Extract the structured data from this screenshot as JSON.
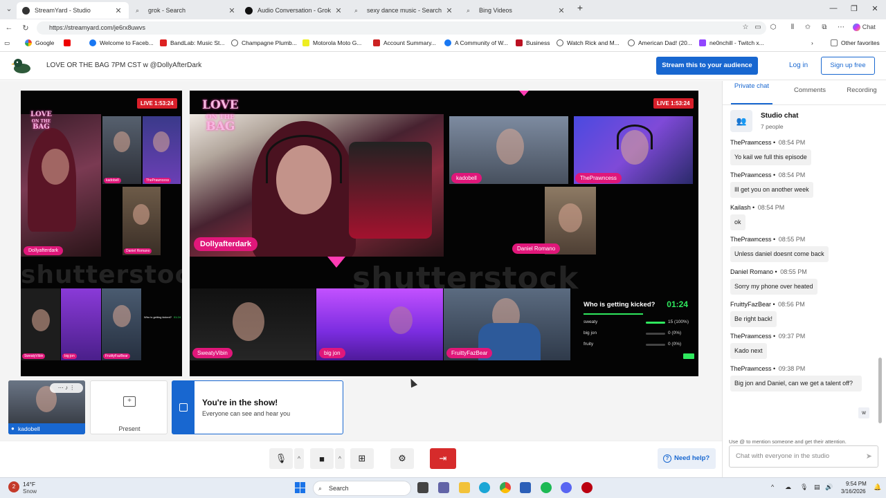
{
  "browser": {
    "tabs": [
      {
        "label": "StreamYard - Studio",
        "active": true,
        "icon": "streamyard-icon"
      },
      {
        "label": "grok - Search",
        "active": false,
        "icon": "search-icon"
      },
      {
        "label": "Audio Conversation - Grok",
        "active": false,
        "icon": "grok-icon"
      },
      {
        "label": "sexy dance music - Search",
        "active": false,
        "icon": "search-icon"
      },
      {
        "label": "Bing Videos",
        "active": false,
        "icon": "search-icon"
      }
    ],
    "url": "https://streamyard.com/je6rx8uwvs",
    "chat_label": "Chat",
    "bookmarks": [
      "Google",
      "",
      "Welcome to Faceb...",
      "BandLab: Music St...",
      "Champagne Plumb...",
      "Motorola Moto G...",
      "Account Summary...",
      "A Community of W...",
      "Business",
      "Watch Rick and M...",
      "American Dad! (20...",
      "ne0nchill - Twitch x..."
    ],
    "other_favorites": "Other favorites"
  },
  "header": {
    "title": "LOVE OR THE BAG 7PM CST w @DollyAfterDark",
    "stream_button": "Stream this to your audience",
    "login": "Log in",
    "signup": "Sign up free"
  },
  "stage": {
    "live_small": "LIVE 1:53:24",
    "live_big": "LIVE 1:53:24",
    "logo_line1": "LOVE",
    "logo_line2": "ON THE",
    "logo_line3": "BAG",
    "watermark": "shutterstock",
    "names": {
      "dolly": "Dollyafterdark",
      "kado": "kadobell",
      "prawn": "ThePrawncess",
      "daniel": "Daniel Romano",
      "sweaty": "SweatyVibin",
      "bigjon": "big jon",
      "fruitty": "FruittyFazBear"
    },
    "poll": {
      "question": "Who is getting kicked?",
      "timer": "01:24",
      "options": [
        {
          "name": "sweaty",
          "count": "15 (100%)",
          "fraction": 1.0
        },
        {
          "name": "big jon",
          "count": "0 (0%)",
          "fraction": 0
        },
        {
          "name": "fruity",
          "count": "0 (0%)",
          "fraction": 0
        }
      ]
    }
  },
  "tiles": {
    "self_name": "kadobell",
    "present": "Present",
    "inshow_title": "You're in the show!",
    "inshow_sub": "Everyone can see and hear you"
  },
  "controls": {
    "help": "Need help?"
  },
  "sidebar": {
    "tabs": [
      "Private chat",
      "Comments",
      "Recording"
    ],
    "chat_title": "Studio chat",
    "chat_people": "7 people",
    "messages": [
      {
        "author": "ThePrawncess",
        "time": "08:54 PM",
        "text": "Yo kail we full this episode"
      },
      {
        "author": "ThePrawncess",
        "time": "08:54 PM",
        "text": "Ill get you on another week"
      },
      {
        "author": "Kailash",
        "time": "08:54 PM",
        "text": "ok"
      },
      {
        "author": "ThePrawncess",
        "time": "08:55 PM",
        "text": "Unless daniel doesnt come back"
      },
      {
        "author": "Daniel Romano",
        "time": "08:55 PM",
        "text": "Sorry my phone over heated"
      },
      {
        "author": "FruittyFazBear",
        "time": "08:56 PM",
        "text": "Be right back!"
      },
      {
        "author": "ThePrawncess",
        "time": "09:37 PM",
        "text": "Kado next"
      },
      {
        "author": "ThePrawncess",
        "time": "09:38 PM",
        "text": "Big jon and Daniel, can we get a talent off?"
      }
    ],
    "w_badge": "w",
    "mention_hint": "Use @ to mention someone and get their attention.",
    "input_placeholder": "Chat with everyone in the studio"
  },
  "taskbar": {
    "weather_temp": "14°F",
    "weather_desc": "Snow",
    "weather_badge": "2",
    "search": "Search",
    "time": "9:54 PM",
    "date": "3/16/2026"
  },
  "colors": {
    "accent": "#1867d0",
    "live": "#d81f2a",
    "nametag": "#e0177a",
    "poll_green": "#2fe85e"
  }
}
